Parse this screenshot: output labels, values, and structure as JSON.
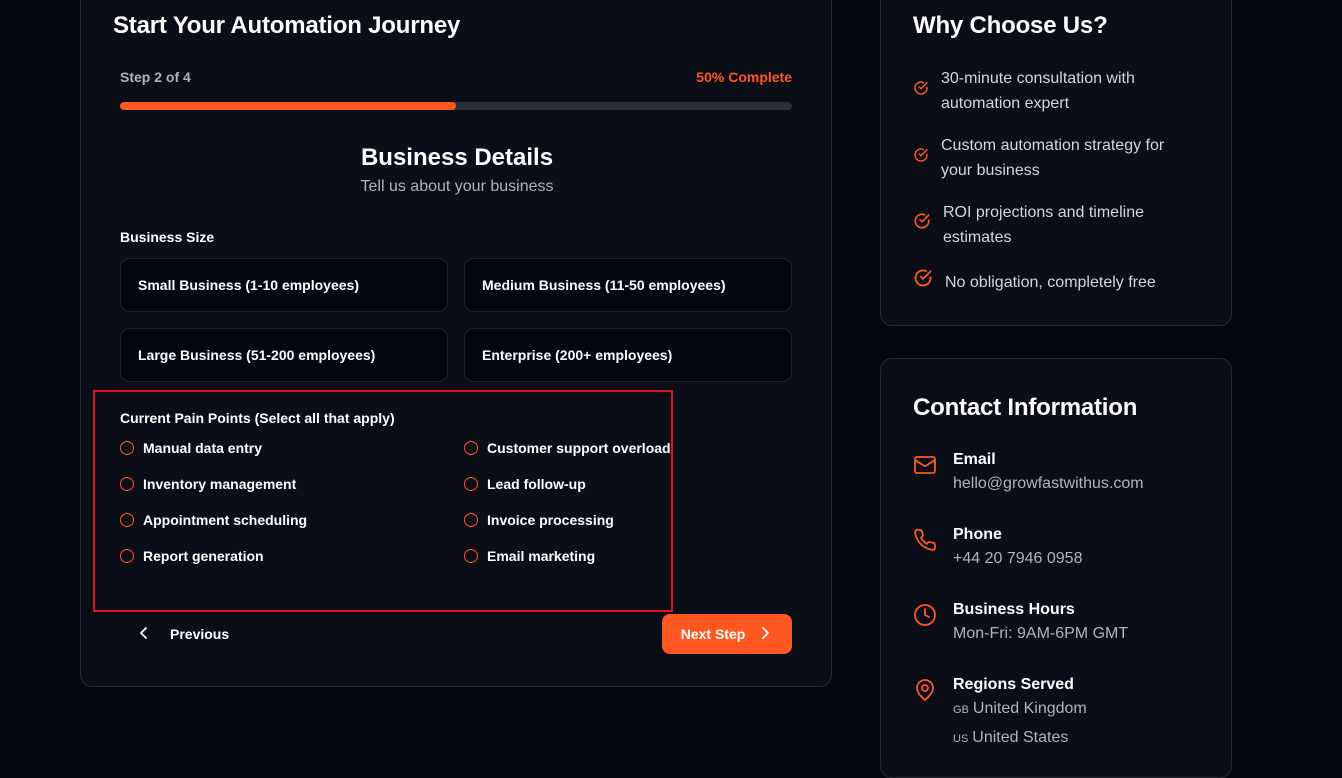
{
  "form": {
    "title": "Start Your Automation Journey",
    "step_text": "Step 2 of 4",
    "percent_text": "50% Complete",
    "progress": 0.5,
    "section_title": "Business Details",
    "section_subtitle": "Tell us about your business",
    "business_size_label": "Business Size",
    "business_sizes": [
      "Small Business (1-10 employees)",
      "Medium Business (11-50 employees)",
      "Large Business (51-200 employees)",
      "Enterprise (200+ employees)"
    ],
    "pain_points_label": "Current Pain Points (Select all that apply)",
    "pain_points": [
      "Manual data entry",
      "Customer support overload",
      "Inventory management",
      "Lead follow-up",
      "Appointment scheduling",
      "Invoice processing",
      "Report generation",
      "Email marketing"
    ],
    "previous_label": "Previous",
    "next_label": "Next Step"
  },
  "why": {
    "title": "Why Choose Us?",
    "items": [
      "30-minute consultation with automation expert",
      "Custom automation strategy for your business",
      "ROI projections and timeline estimates",
      "No obligation, completely free"
    ]
  },
  "contact": {
    "title": "Contact Information",
    "email_label": "Email",
    "email": "hello@growfastwithus.com",
    "phone_label": "Phone",
    "phone": "+44 20 7946 0958",
    "hours_label": "Business Hours",
    "hours": "Mon-Fri: 9AM-6PM GMT",
    "regions_label": "Regions Served",
    "regions": [
      {
        "code": "GB",
        "name": "United Kingdom"
      },
      {
        "code": "US",
        "name": "United States"
      }
    ]
  },
  "colors": {
    "accent": "#ff5722",
    "background": "#03060f",
    "card": "#0b0e17",
    "highlight": "#e0141e"
  }
}
